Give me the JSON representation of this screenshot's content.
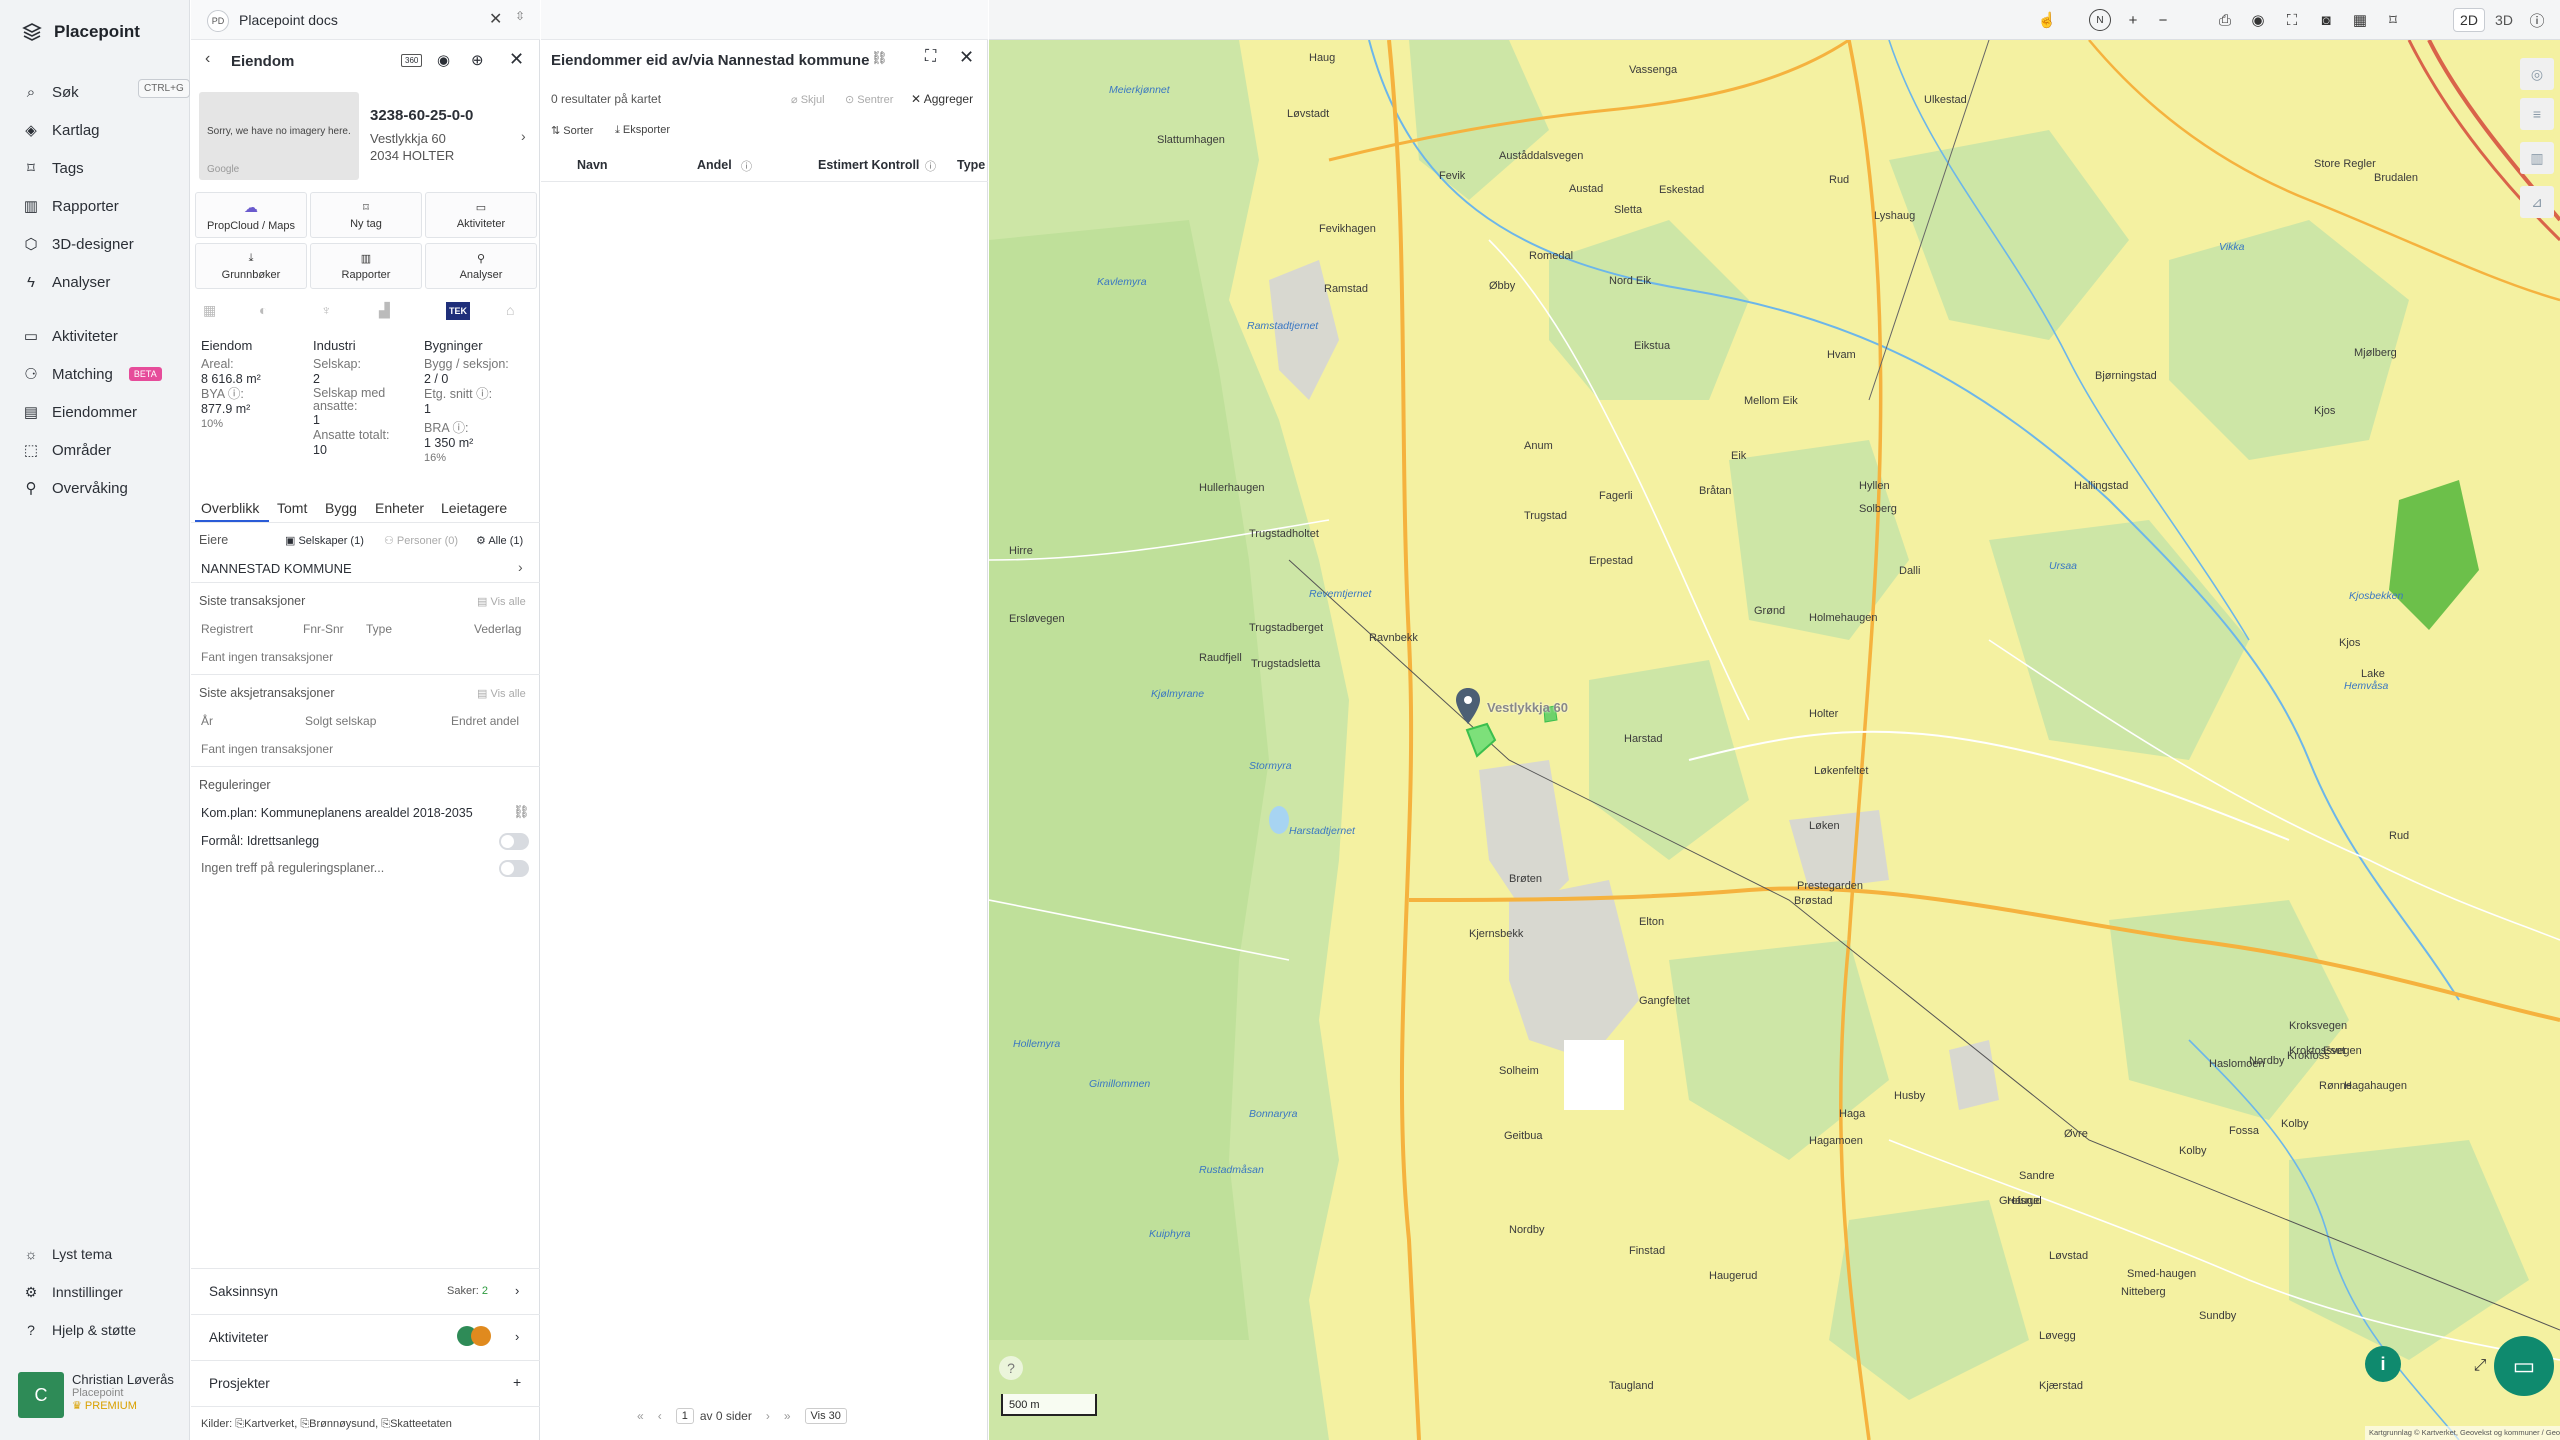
{
  "nav": {
    "app_name": "Placepoint",
    "items": [
      {
        "label": "Søk",
        "shortcut": "CTRL+G"
      },
      {
        "label": "Kartlag"
      },
      {
        "label": "Tags"
      },
      {
        "label": "Rapporter"
      },
      {
        "label": "3D-designer"
      },
      {
        "label": "Analyser"
      },
      {
        "label": "Aktiviteter"
      },
      {
        "label": "Matching",
        "badge": "BETA"
      },
      {
        "label": "Eiendommer"
      },
      {
        "label": "Områder"
      },
      {
        "label": "Overvåking"
      }
    ],
    "bottom": [
      {
        "label": "Lyst tema"
      },
      {
        "label": "Innstillinger"
      },
      {
        "label": "Hjelp & støtte"
      }
    ],
    "user": {
      "initial": "C",
      "name": "Christian Løverås",
      "org": "Placepoint",
      "tier": "PREMIUM"
    }
  },
  "tabbar": {
    "chip": "PD",
    "title": "Placepoint docs"
  },
  "property": {
    "header": "Eiendom",
    "id": "3238-60-25-0-0",
    "street": "Vestlykkja 60",
    "postal": "2034 HOLTER",
    "imagery_msg": "Sorry, we have no imagery here.",
    "imagery_brand": "Google",
    "tiles": [
      "PropCloud / Maps",
      "Ny tag",
      "Aktiviteter",
      "Grunnbøker",
      "Rapporter",
      "Analyser"
    ],
    "tek_label": "TEK",
    "col1": {
      "title": "Eiendom",
      "areal_label": "Areal:",
      "areal_value": "8 616.8",
      "areal_unit": "m²",
      "bya_label": "BYA",
      "bya_value": "877.9",
      "bya_unit": "m²",
      "bya_pct": "10%"
    },
    "col2": {
      "title": "Industri",
      "selskap_label": "Selskap:",
      "selskap_value": "2",
      "ansatte_label": "Selskap med ansatte:",
      "ansatte_value": "1",
      "ansatte_tot_label": "Ansatte totalt:",
      "ansatte_tot_value": "10"
    },
    "col3": {
      "title": "Bygninger",
      "bygg_label": "Bygg / seksjon:",
      "bygg_value": "2 / 0",
      "etg_label": "Etg. snitt",
      "etg_value": "1",
      "bra_label": "BRA",
      "bra_value": "1 350",
      "bra_unit": "m²",
      "bra_pct": "16%"
    },
    "tabs": [
      "Overblikk",
      "Tomt",
      "Bygg",
      "Enheter",
      "Leietagere"
    ],
    "owners": {
      "label": "Eiere",
      "f1": "Selskaper (1)",
      "f2": "Personer (0)",
      "f3": "Alle (1)",
      "owner": "NANNESTAD KOMMUNE"
    },
    "trans": {
      "title": "Siste transaksjoner",
      "show_all": "Vis alle",
      "cols": [
        "Registrert",
        "Fnr-Snr",
        "Type",
        "Vederlag"
      ],
      "empty": "Fant ingen transaksjoner"
    },
    "shares": {
      "title": "Siste aksjetransaksjoner",
      "show_all": "Vis alle",
      "cols": [
        "År",
        "Solgt selskap",
        "Endret andel"
      ],
      "empty": "Fant ingen transaksjoner"
    },
    "reg": {
      "title": "Reguleringer",
      "plan": "Kom.plan: Kommuneplanens arealdel 2018-2035",
      "formal": "Formål: Idrettsanlegg",
      "none": "Ingen treff på reguleringsplaner..."
    },
    "bottom": {
      "saks": "Saksinnsyn",
      "saker_label": "Saker:",
      "saker_value": "2",
      "akt": "Aktiviteter",
      "prosj": "Prosjekter"
    },
    "sources": {
      "label": "Kilder:",
      "s1": "Kartverket,",
      "s2": "Brønnøysund,",
      "s3": "Skatteetaten"
    }
  },
  "list": {
    "title": "Eiendommer eid av/via Nannestad kommune",
    "results": "0 resultater på kartet",
    "skjul": "Skjul",
    "sentrer": "Sentrer",
    "aggreger": "Aggreger",
    "sorter": "Sorter",
    "eksporter": "Eksporter",
    "cols": [
      "Navn",
      "Andel",
      "Estimert Kontroll",
      "Type"
    ],
    "pager": {
      "page": "1",
      "of": "av 0 sider",
      "per": "Vis 30"
    }
  },
  "map": {
    "mode_2d": "2D",
    "mode_3d": "3D",
    "scale": "500 m",
    "attribution": "Kartgrunnlag © Kartverket, Geovekst og kommuner / Geodata AS, Powered by Esri",
    "marker_label": "Vestlykkja 60",
    "places": [
      "Haug",
      "Løvstadt",
      "Slattumhagen",
      "Vassenga",
      "Ulkestad",
      "Fevik",
      "Auståddalsvegen",
      "Fevikhagen",
      "Ramstad",
      "Øbby",
      "Romedal",
      "Nord Eik",
      "Eikstua",
      "Mellom Eik",
      "Eik",
      "Hvam",
      "Bjørningstad",
      "Anum",
      "Trugstad",
      "Erpestad",
      "Grønd",
      "Holmehaugen",
      "Hullerhaugen",
      "Trugstadholtet",
      "Trugstadberget",
      "Trugstadsletta",
      "Ravnbekk",
      "Raudfjell",
      "Harstad",
      "Holter",
      "Løkenfeltet",
      "Løken",
      "Prestegarden",
      "Brøten",
      "Elton",
      "Gangfeltet",
      "Brøstad",
      "Kjernsbekk",
      "Solheim",
      "Geitbua",
      "Nordby",
      "Finstad",
      "Haugerud",
      "Løvstad",
      "Sundby",
      "Kolby",
      "Haga",
      "Hagamoen",
      "Øvre",
      "Grefsrud",
      "Sandre",
      "Nitteberg",
      "Løvegg",
      "Kjærstad",
      "Taugland",
      "Smed-haugen",
      "Fossa",
      "Kroktossvegen",
      "Haslomoen",
      "Hirre",
      "Ersløvegen",
      "Rud",
      "Lyshaug",
      "Kjos",
      "Kjos",
      "Lake",
      "Rud",
      "Dalli",
      "Hyllen",
      "Solberg",
      "Fagerli",
      "Hallingstad",
      "Store Regler",
      "Brudalen",
      "Mjølberg",
      "Eskestad",
      "Austad",
      "Sletta",
      "Bråtan",
      "Husby",
      "Hauge",
      "Nordby",
      "Kroksvegen",
      "Eset",
      "Rønne",
      "Kolby",
      "Krokfoss",
      "Hagahaugen"
    ],
    "water": [
      "Meierkjønnet",
      "Kavlemyra",
      "Ramstadtjernet",
      "Revemtjernet",
      "Kjølmyrane",
      "Stormyra",
      "Harstadtjernet",
      "Hollemyra",
      "Gimillommen",
      "Bonnaryra",
      "Rustadmåsan",
      "Kuiphyra",
      "Vikka",
      "Kjosbekken",
      "Hemvåsa",
      "Ursaa"
    ]
  }
}
